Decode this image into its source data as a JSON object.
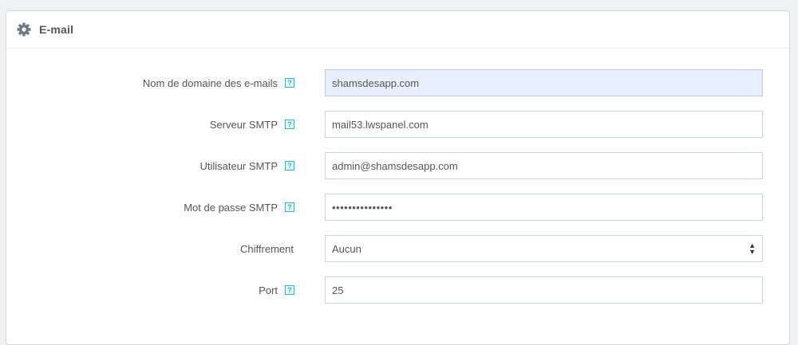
{
  "panel": {
    "title": "E-mail",
    "icon": "gear-icon"
  },
  "fields": {
    "domain": {
      "label": "Nom de domaine des e-mails",
      "value": "shamsdesapp.com"
    },
    "smtp_server": {
      "label": "Serveur SMTP",
      "value": "mail53.lwspanel.com"
    },
    "smtp_user": {
      "label": "Utilisateur SMTP",
      "value": "admin@shamsdesapp.com"
    },
    "smtp_password": {
      "label": "Mot de passe SMTP",
      "value": "•••••••••••••••"
    },
    "encryption": {
      "label": "Chiffrement",
      "value": "Aucun"
    },
    "port": {
      "label": "Port",
      "value": "25"
    }
  },
  "help_glyph": "?",
  "colors": {
    "accent": "#25b9d7",
    "autofill": "#e8f0fe",
    "border": "#c7d6db"
  }
}
